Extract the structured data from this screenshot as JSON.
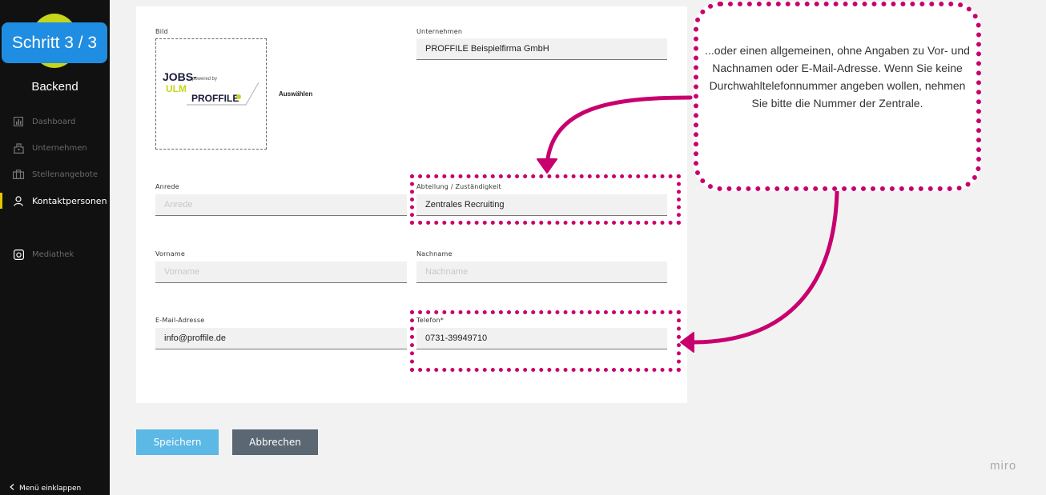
{
  "sidebar": {
    "step_badge": "Schritt 3 / 3",
    "brand": "Backend",
    "items": [
      {
        "label": "Dashboard",
        "icon": "dashboard-icon"
      },
      {
        "label": "Unternehmen",
        "icon": "building-icon"
      },
      {
        "label": "Stellenangebote",
        "icon": "briefcase-icon"
      },
      {
        "label": "Kontaktpersonen",
        "icon": "person-icon",
        "active": true
      },
      {
        "label": "Mediathek",
        "icon": "camera-icon"
      }
    ],
    "collapse_label": "Menü einklappen"
  },
  "form": {
    "image_label": "Bild",
    "choose_label": "Auswählen",
    "logo": {
      "line1": "JOBS-",
      "line2": "ULM",
      "powered": "powered by",
      "brand": "PROFFILE"
    },
    "company_label": "Unternehmen",
    "company_value": "PROFFILE Beispielfirma GmbH",
    "salutation_label": "Anrede",
    "salutation_placeholder": "Anrede",
    "department_label": "Abteilung / Zuständigkeit",
    "department_value": "Zentrales Recruiting",
    "firstname_label": "Vorname",
    "firstname_placeholder": "Vorname",
    "lastname_label": "Nachname",
    "lastname_placeholder": "Nachname",
    "email_label": "E-Mail-Adresse",
    "email_value": "info@proffile.de",
    "phone_label": "Telefon*",
    "phone_value": "0731-39949710"
  },
  "buttons": {
    "save": "Speichern",
    "cancel": "Abbrechen"
  },
  "annotation": {
    "text": "...oder einen allgemeinen, ohne Angaben zu Vor- und Nachnamen oder E-Mail-Adresse. Wenn Sie keine Durchwahltelefonnummer angeben wollen, nehmen Sie bitte die Nummer der Zentrale."
  },
  "watermark": "miro",
  "colors": {
    "accent_blue": "#1f8de1",
    "annotation_pink": "#c8006e",
    "save_button": "#5cb8e4",
    "cancel_button": "#5b6773",
    "active_marker": "#e8c400",
    "logo_green": "#c6d51a"
  }
}
